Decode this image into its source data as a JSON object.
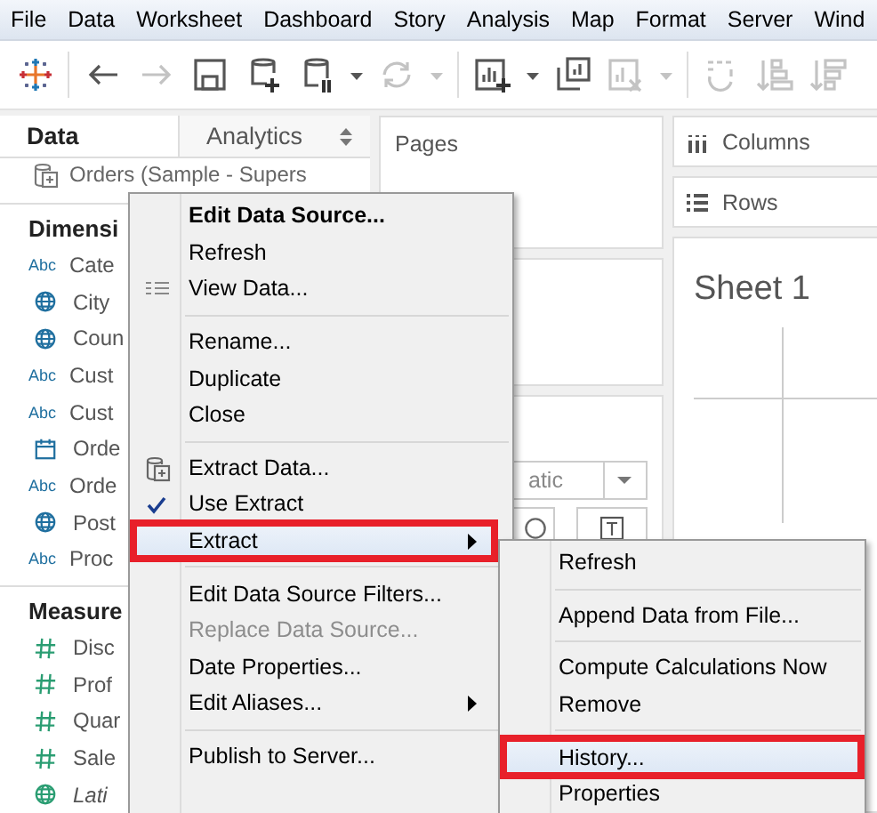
{
  "menu_bar": [
    "File",
    "Data",
    "Worksheet",
    "Dashboard",
    "Story",
    "Analysis",
    "Map",
    "Format",
    "Server",
    "Wind"
  ],
  "toolbar": [
    {
      "kind": "logo",
      "disabled": false
    },
    {
      "kind": "sep"
    },
    {
      "kind": "back",
      "disabled": false
    },
    {
      "kind": "forward",
      "disabled": true
    },
    {
      "kind": "save",
      "disabled": false
    },
    {
      "kind": "db-add",
      "disabled": false
    },
    {
      "kind": "db-pause",
      "disabled": false
    },
    {
      "kind": "caret",
      "disabled": false
    },
    {
      "kind": "refresh",
      "disabled": true
    },
    {
      "kind": "caret",
      "disabled": true
    },
    {
      "kind": "sep"
    },
    {
      "kind": "chart-add",
      "disabled": false
    },
    {
      "kind": "caret",
      "disabled": false
    },
    {
      "kind": "chart-copy",
      "disabled": false
    },
    {
      "kind": "chart-clear",
      "disabled": true
    },
    {
      "kind": "caret",
      "disabled": true
    },
    {
      "kind": "sep"
    },
    {
      "kind": "swap",
      "disabled": true
    },
    {
      "kind": "sort-asc",
      "disabled": true
    },
    {
      "kind": "sort-desc",
      "disabled": true
    }
  ],
  "data_pane": {
    "tabs": [
      {
        "label": "Data",
        "selected": true
      },
      {
        "label": "Analytics",
        "selected": false
      }
    ],
    "data_source": "Orders (Sample - Supers",
    "sections": [
      {
        "title": "Dimensi",
        "fields": [
          {
            "name": "Cate",
            "kind": "string",
            "badge": "Abc",
            "italic": false
          },
          {
            "name": "City",
            "kind": "geo",
            "italic": false
          },
          {
            "name": "Coun",
            "kind": "geo",
            "italic": false
          },
          {
            "name": "Cust",
            "kind": "string",
            "badge": "Abc",
            "italic": false
          },
          {
            "name": "Cust",
            "kind": "string",
            "badge": "Abc",
            "italic": false
          },
          {
            "name": "Orde",
            "kind": "date",
            "italic": false
          },
          {
            "name": "Orde",
            "kind": "string",
            "badge": "Abc",
            "italic": false
          },
          {
            "name": "Post",
            "kind": "geo",
            "italic": false
          },
          {
            "name": "Proc",
            "kind": "string",
            "badge": "Abc",
            "italic": false
          }
        ]
      },
      {
        "title": "Measure",
        "fields": [
          {
            "name": "Disc",
            "kind": "number",
            "italic": false
          },
          {
            "name": "Prof",
            "kind": "number",
            "italic": false
          },
          {
            "name": "Quar",
            "kind": "number",
            "italic": false
          },
          {
            "name": "Sale",
            "kind": "number",
            "italic": false
          },
          {
            "name": "Lati",
            "kind": "geo-measure",
            "italic": true
          }
        ]
      }
    ]
  },
  "pages_card": {
    "title": "Pages"
  },
  "marks_card": {
    "mark_type": "atic"
  },
  "shelves": [
    {
      "label": "Columns",
      "kind": "columns"
    },
    {
      "label": "Rows",
      "kind": "rows"
    }
  ],
  "sheet": {
    "title": "Sheet 1"
  },
  "context_menu": {
    "items": [
      {
        "kind": "plain",
        "label": "Edit Data Source...",
        "bold": true,
        "disabled": false,
        "checked": false,
        "submenu": false,
        "selected": false,
        "outlined": false
      },
      {
        "kind": "plain",
        "label": "Refresh",
        "bold": false,
        "disabled": false,
        "checked": false,
        "submenu": false,
        "selected": false,
        "outlined": false
      },
      {
        "kind": "table",
        "label": "View Data...",
        "bold": false,
        "disabled": false,
        "checked": false,
        "submenu": false,
        "selected": false,
        "outlined": false
      },
      {
        "kind": "separator"
      },
      {
        "kind": "plain",
        "label": "Rename...",
        "bold": false,
        "disabled": false,
        "checked": false,
        "submenu": false,
        "selected": false,
        "outlined": false
      },
      {
        "kind": "plain",
        "label": "Duplicate",
        "bold": false,
        "disabled": false,
        "checked": false,
        "submenu": false,
        "selected": false,
        "outlined": false
      },
      {
        "kind": "plain",
        "label": "Close",
        "bold": false,
        "disabled": false,
        "checked": false,
        "submenu": false,
        "selected": false,
        "outlined": false
      },
      {
        "kind": "separator"
      },
      {
        "kind": "database",
        "label": "Extract Data...",
        "bold": false,
        "disabled": false,
        "checked": false,
        "submenu": false,
        "selected": false,
        "outlined": false
      },
      {
        "kind": "plain",
        "label": "Use Extract",
        "bold": false,
        "disabled": false,
        "checked": true,
        "submenu": false,
        "selected": false,
        "outlined": false
      },
      {
        "kind": "plain",
        "label": "Extract",
        "bold": false,
        "disabled": false,
        "checked": false,
        "submenu": true,
        "selected": true,
        "outlined": true
      },
      {
        "kind": "separator"
      },
      {
        "kind": "plain",
        "label": "Edit Data Source Filters...",
        "bold": false,
        "disabled": false,
        "checked": false,
        "submenu": false,
        "selected": false,
        "outlined": false
      },
      {
        "kind": "plain",
        "label": "Replace Data Source...",
        "bold": false,
        "disabled": true,
        "checked": false,
        "submenu": false,
        "selected": false,
        "outlined": false
      },
      {
        "kind": "plain",
        "label": "Date Properties...",
        "bold": false,
        "disabled": false,
        "checked": false,
        "submenu": false,
        "selected": false,
        "outlined": false
      },
      {
        "kind": "plain",
        "label": "Edit Aliases...",
        "bold": false,
        "disabled": false,
        "checked": false,
        "submenu": true,
        "selected": false,
        "outlined": false
      },
      {
        "kind": "separator"
      },
      {
        "kind": "plain",
        "label": "Publish to Server...",
        "bold": false,
        "disabled": false,
        "checked": false,
        "submenu": false,
        "selected": false,
        "outlined": false
      }
    ]
  },
  "submenu": {
    "items": [
      {
        "kind": "item",
        "label": "Refresh",
        "selected": false,
        "outlined": false
      },
      {
        "kind": "separator"
      },
      {
        "kind": "item",
        "label": "Append Data from File...",
        "selected": false,
        "outlined": false
      },
      {
        "kind": "separator"
      },
      {
        "kind": "item",
        "label": "Compute Calculations Now",
        "selected": false,
        "outlined": false
      },
      {
        "kind": "item",
        "label": "Remove",
        "selected": false,
        "outlined": false
      },
      {
        "kind": "separator"
      },
      {
        "kind": "item",
        "label": "History...",
        "selected": true,
        "outlined": true
      },
      {
        "kind": "item",
        "label": "Properties",
        "selected": false,
        "outlined": false
      }
    ]
  }
}
